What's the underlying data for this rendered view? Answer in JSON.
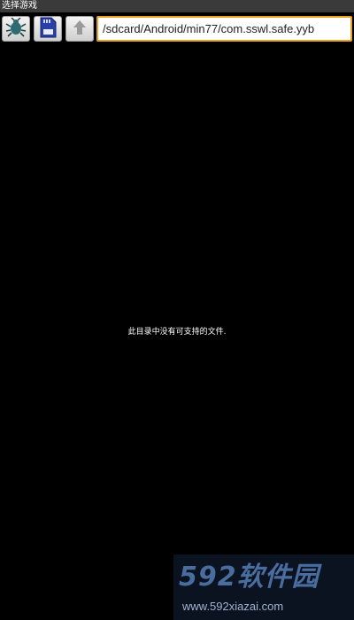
{
  "window": {
    "title": "选择游戏"
  },
  "toolbar": {
    "buttons": [
      {
        "name": "debug",
        "icon": "bug-icon"
      },
      {
        "name": "sdcard",
        "icon": "sdcard-icon"
      },
      {
        "name": "parent-directory",
        "icon": "arrow-up-icon"
      }
    ],
    "path_value": "/sdcard/Android/min77/com.sswl.safe.yyb",
    "path_border_color": "#e8a020"
  },
  "file_list": {
    "empty_message": "此目录中没有可支持的文件."
  },
  "watermark": {
    "logo_text": "592软件园",
    "url": "www.592xiazai.com"
  }
}
